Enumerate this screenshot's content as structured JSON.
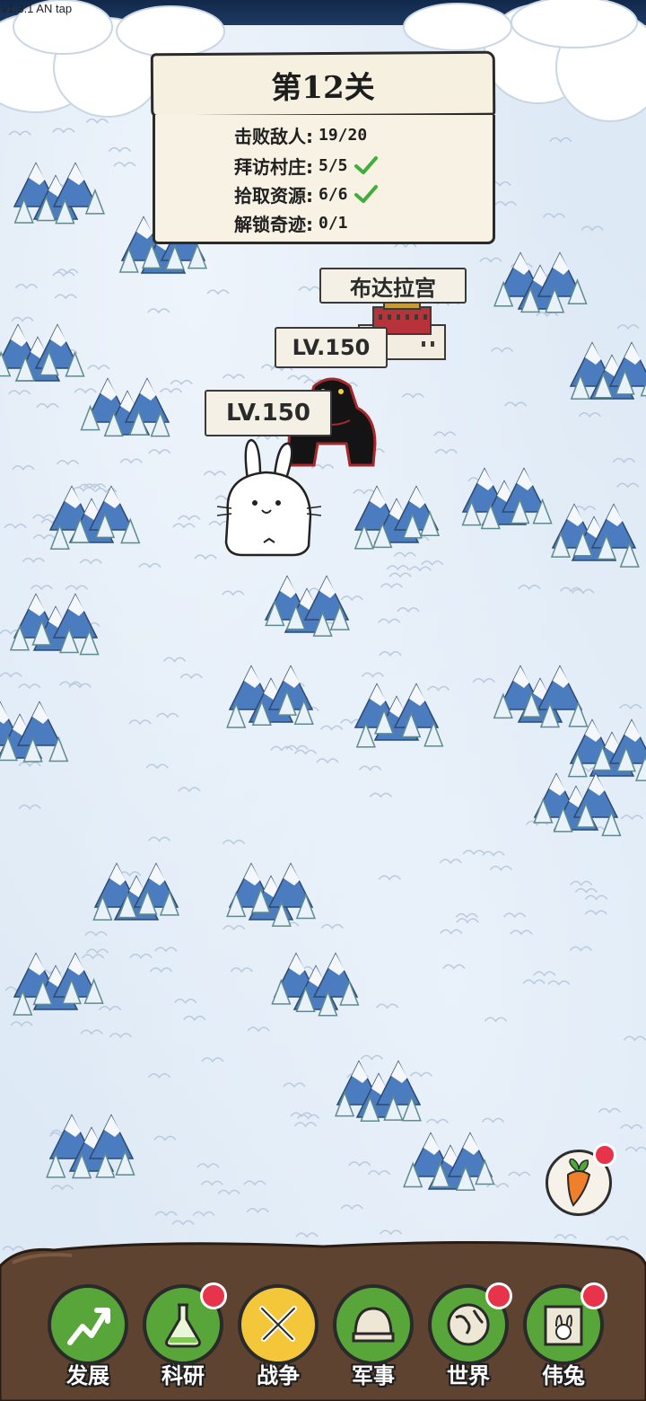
{
  "version": "v1.3.1 AN tap",
  "level": {
    "title": "第12关",
    "objectives": [
      {
        "label": "击败敌人:",
        "value": "19/20",
        "done": false
      },
      {
        "label": "拜访村庄:",
        "value": "5/5",
        "done": true
      },
      {
        "label": "拾取资源:",
        "value": "6/6",
        "done": true
      },
      {
        "label": "解锁奇迹:",
        "value": "0/1",
        "done": false
      }
    ]
  },
  "map": {
    "landmark_label": "布达拉宫",
    "enemy_level": "LV.150",
    "player_level": "LV.150"
  },
  "nav": {
    "items": [
      {
        "label": "发展",
        "icon": "growth-arrow-icon",
        "badge": false,
        "active": false
      },
      {
        "label": "科研",
        "icon": "flask-icon",
        "badge": true,
        "active": false
      },
      {
        "label": "战争",
        "icon": "crossed-swords-icon",
        "badge": false,
        "active": true
      },
      {
        "label": "军事",
        "icon": "helmet-icon",
        "badge": false,
        "active": false
      },
      {
        "label": "世界",
        "icon": "globe-icon",
        "badge": true,
        "active": false
      },
      {
        "label": "伟兔",
        "icon": "rabbit-portrait-icon",
        "badge": true,
        "active": false
      }
    ]
  },
  "colors": {
    "nav_green": "#58a53a",
    "nav_active": "#f4c63a",
    "badge_red": "#e8344a",
    "ground_brown": "#5e4331"
  }
}
